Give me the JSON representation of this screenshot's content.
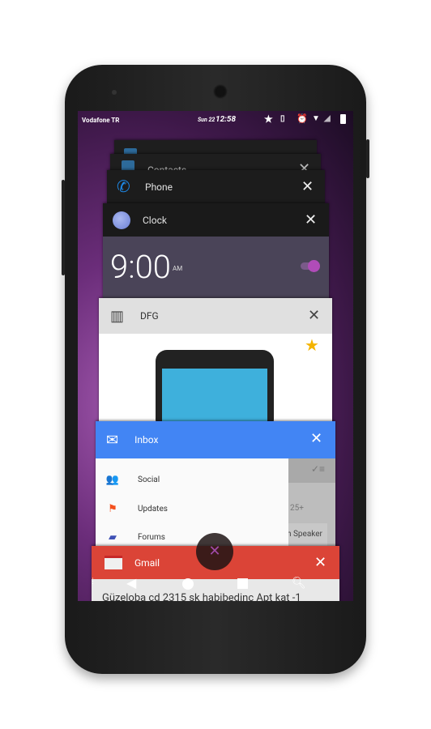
{
  "status_bar": {
    "carrier": "Vodafone TR",
    "date": "Sun 22",
    "time": "12:58"
  },
  "recents": [
    {
      "app": "Contacts"
    },
    {
      "app": "Phone"
    },
    {
      "app": "Clock",
      "alarm_time": "9:00",
      "alarm_ampm": "AM",
      "alarm_on": true
    },
    {
      "app": "DFG"
    },
    {
      "app": "Inbox",
      "drawer_items": [
        {
          "label": "Social",
          "icon": "people-icon",
          "color": "#db4437"
        },
        {
          "label": "Updates",
          "icon": "flag-icon",
          "color": "#f4511e"
        },
        {
          "label": "Forums",
          "icon": "forum-icon",
          "color": "#3f51b5"
        }
      ],
      "behind_count": "25+",
      "behind_text": "h Speaker"
    },
    {
      "app": "Gmail",
      "preview": "Güzeloba cd 2315 sk habibedinc Apt kat -1"
    }
  ],
  "colors": {
    "inbox": "#4285f4",
    "gmail": "#db4437",
    "dfg_header": "#e0e0e0"
  }
}
